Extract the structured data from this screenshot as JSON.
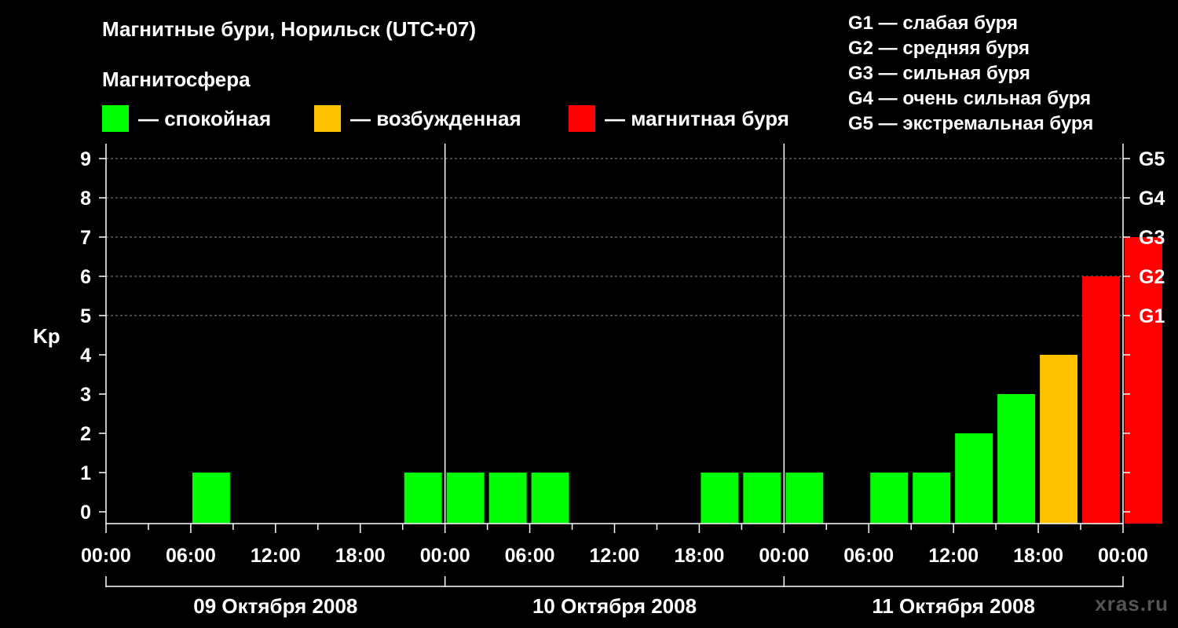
{
  "title": "Магнитные бури, Норильск (UTC+07)",
  "subtitle": "Магнитосфера",
  "legend": [
    {
      "label": "— спокойная",
      "color": "#00ff00"
    },
    {
      "label": "— возбужденная",
      "color": "#ffc000"
    },
    {
      "label": "— магнитная буря",
      "color": "#ff0000"
    }
  ],
  "g_legend": [
    "G1 — слабая буря",
    "G2 — средняя буря",
    "G3 — сильная буря",
    "G4 — очень сильная буря",
    "G5 — экстремальная буря"
  ],
  "watermark": "xras.ru",
  "chart_data": {
    "type": "bar",
    "ylabel": "Kp",
    "ylim": [
      0,
      9
    ],
    "y_ticks": [
      "0",
      "1",
      "2",
      "3",
      "4",
      "5",
      "6",
      "7",
      "8",
      "9"
    ],
    "g_ticks": [
      {
        "kp": 5,
        "label": "G1"
      },
      {
        "kp": 6,
        "label": "G2"
      },
      {
        "kp": 7,
        "label": "G3"
      },
      {
        "kp": 8,
        "label": "G4"
      },
      {
        "kp": 9,
        "label": "G5"
      }
    ],
    "x_tick_labels": [
      "00:00",
      "06:00",
      "12:00",
      "18:00",
      "00:00",
      "06:00",
      "12:00",
      "18:00",
      "00:00",
      "06:00",
      "12:00",
      "18:00",
      "00:00"
    ],
    "days": [
      "09 Октября 2008",
      "10 Октября 2008",
      "11 Октября 2008"
    ],
    "interval_hours": 3,
    "grid": "dashed horizontal at Kp 5–9",
    "colors": {
      "quiet": "#00ff00",
      "active": "#ffc000",
      "storm": "#ff0000"
    },
    "values": [
      0,
      0,
      1,
      0,
      0,
      0,
      0,
      1,
      1,
      1,
      1,
      0,
      0,
      0,
      1,
      1,
      1,
      0,
      1,
      1,
      2,
      3,
      4,
      6,
      7
    ]
  }
}
